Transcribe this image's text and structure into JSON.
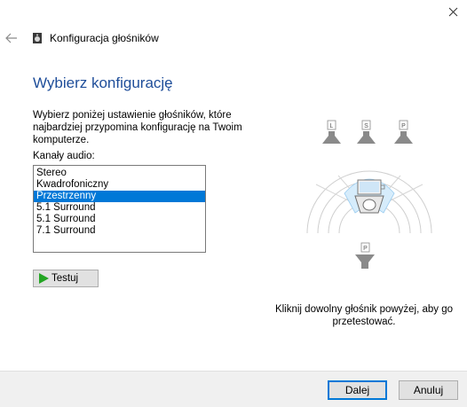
{
  "window": {
    "title": "Konfiguracja głośników",
    "close_icon": "close-icon",
    "back_icon": "back-arrow-icon",
    "app_icon": "speaker-icon"
  },
  "main": {
    "heading": "Wybierz konfigurację",
    "description": "Wybierz poniżej ustawienie głośników, które najbardziej przypomina konfigurację na Twoim komputerze.",
    "channels_label": "Kanały audio:",
    "channels": [
      {
        "label": "Stereo",
        "selected": false
      },
      {
        "label": "Kwadrofoniczny",
        "selected": false
      },
      {
        "label": "Przestrzenny",
        "selected": true
      },
      {
        "label": "5.1 Surround",
        "selected": false
      },
      {
        "label": "5.1 Surround",
        "selected": false
      },
      {
        "label": "7.1 Surround",
        "selected": false
      }
    ],
    "test_button_label": "Testuj"
  },
  "diagram": {
    "front_left_label": "L",
    "center_label": "S",
    "front_right_label": "P",
    "rear_label": "P",
    "colors": {
      "highlight": "#d6ecfb",
      "speaker": "#8a8a8a"
    }
  },
  "hint": "Kliknij dowolny głośnik powyżej, aby go przetestować.",
  "footer": {
    "next_label": "Dalej",
    "cancel_label": "Anuluj"
  },
  "colors": {
    "accent": "#0078d7",
    "heading": "#1f4e9a"
  }
}
